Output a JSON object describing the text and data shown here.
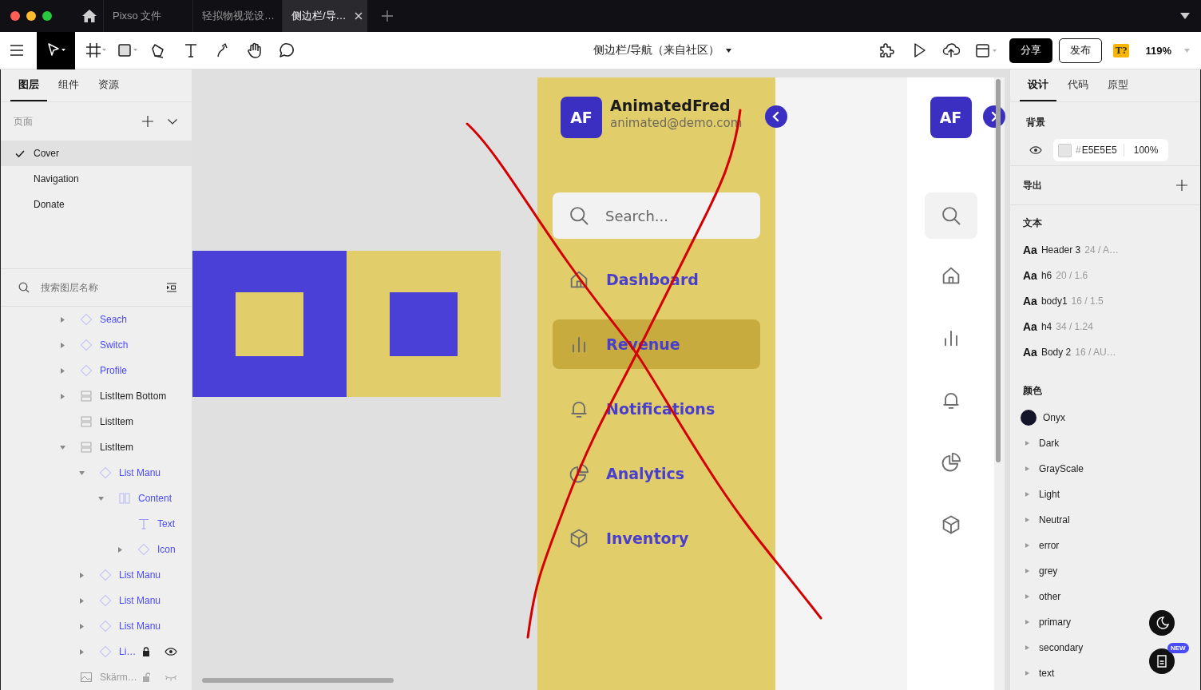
{
  "browser_tabs": [
    {
      "label": "Pixso 文件",
      "selected": false
    },
    {
      "label": "轻拟物视觉设…",
      "selected": false
    },
    {
      "label": "侧边栏/导…",
      "selected": true
    }
  ],
  "toolbar": {
    "tools": [
      {
        "kind": "move",
        "selected": true
      },
      {
        "kind": "frame",
        "selected": false
      },
      {
        "kind": "rect",
        "selected": false
      },
      {
        "kind": "pen",
        "selected": false
      },
      {
        "kind": "text",
        "selected": false
      },
      {
        "kind": "path",
        "selected": false
      },
      {
        "kind": "hand",
        "selected": false
      },
      {
        "kind": "comment",
        "selected": false
      }
    ],
    "file_title": "侧边栏/导航（来自社区）",
    "share": "分享",
    "publish": "发布",
    "badge": "T?",
    "zoom": "119%"
  },
  "left_panel": {
    "tabs": [
      {
        "label": "图层",
        "selected": true
      },
      {
        "label": "组件",
        "selected": false
      },
      {
        "label": "资源",
        "selected": false
      }
    ],
    "pages_label": "页面",
    "pages": [
      {
        "label": "Cover",
        "selected": true
      },
      {
        "label": "Navigation",
        "selected": false
      },
      {
        "label": "Donate",
        "selected": false
      }
    ],
    "search": {
      "placeholder": "搜索图层名称"
    },
    "layers": [
      {
        "name": "Seach",
        "kind": "component",
        "expanded": false
      },
      {
        "name": "Switch",
        "kind": "component",
        "expanded": false
      },
      {
        "name": "Profile",
        "kind": "component",
        "expanded": false
      },
      {
        "name": "ListItem Bottom",
        "kind": "list",
        "expanded": false
      },
      {
        "name": "ListItem",
        "kind": "list"
      },
      {
        "name": "ListItem",
        "kind": "list",
        "expanded": true,
        "children": [
          {
            "name": "List Manu",
            "kind": "component",
            "expanded": true,
            "children": [
              {
                "name": "Content",
                "kind": "frame",
                "expanded": true,
                "children": [
                  {
                    "name": "Text",
                    "kind": "text"
                  },
                  {
                    "name": "Icon",
                    "kind": "component",
                    "expanded": false
                  }
                ]
              }
            ]
          },
          {
            "name": "List Manu",
            "kind": "component",
            "expanded": false
          },
          {
            "name": "List Manu",
            "kind": "component",
            "expanded": false
          },
          {
            "name": "List Manu",
            "kind": "component",
            "expanded": false
          },
          {
            "name": "Li…",
            "kind": "component",
            "expanded": false,
            "locked": true,
            "visible": true
          }
        ]
      },
      {
        "name": "Skärm…",
        "kind": "image",
        "locked": false,
        "visible": false
      }
    ]
  },
  "canvas": {
    "profile": {
      "initials": "AF",
      "name": "AnimatedFred",
      "email": "animated@demo.com"
    },
    "search": {
      "placeholder": "Search..."
    },
    "nav": [
      {
        "label": "Dashboard",
        "kind": "home",
        "selected": false
      },
      {
        "label": "Revenue",
        "kind": "chart",
        "selected": true
      },
      {
        "label": "Notifications",
        "kind": "bell",
        "selected": false
      },
      {
        "label": "Analytics",
        "kind": "pie",
        "selected": false
      },
      {
        "label": "Inventory",
        "kind": "box",
        "selected": false
      }
    ],
    "collapsed_initials": "AF"
  },
  "right_panel": {
    "tabs": [
      {
        "label": "设计",
        "selected": true
      },
      {
        "label": "代码",
        "selected": false
      },
      {
        "label": "原型",
        "selected": false
      }
    ],
    "background": {
      "label": "背景",
      "prefix": "#",
      "hex": "E5E5E5",
      "opacity": "100%"
    },
    "export_label": "导出",
    "text_label": "文本",
    "text_styles": [
      {
        "sample": "Aa",
        "name": "Header 3",
        "spec": "24 / A…"
      },
      {
        "sample": "Aa",
        "name": "h6",
        "spec": "20 / 1.6"
      },
      {
        "sample": "Aa",
        "name": "body1",
        "spec": "16 / 1.5"
      },
      {
        "sample": "Aa",
        "name": "h4",
        "spec": "34 / 1.24"
      },
      {
        "sample": "Aa",
        "name": "Body 2",
        "spec": "16 / AU…"
      }
    ],
    "colors_label": "颜色",
    "color_styles": [
      {
        "name": "Onyx",
        "kind": "swatch",
        "color": "#14142b"
      },
      {
        "name": "Dark",
        "kind": "group"
      },
      {
        "name": "GrayScale",
        "kind": "group"
      },
      {
        "name": "Light",
        "kind": "group"
      },
      {
        "name": "Neutral",
        "kind": "group"
      },
      {
        "name": "error",
        "kind": "group"
      },
      {
        "name": "grey",
        "kind": "group"
      },
      {
        "name": "other",
        "kind": "group"
      },
      {
        "name": "primary",
        "kind": "group"
      },
      {
        "name": "secondary",
        "kind": "group"
      },
      {
        "name": "text",
        "kind": "group"
      }
    ],
    "new_badge": "NEW"
  }
}
